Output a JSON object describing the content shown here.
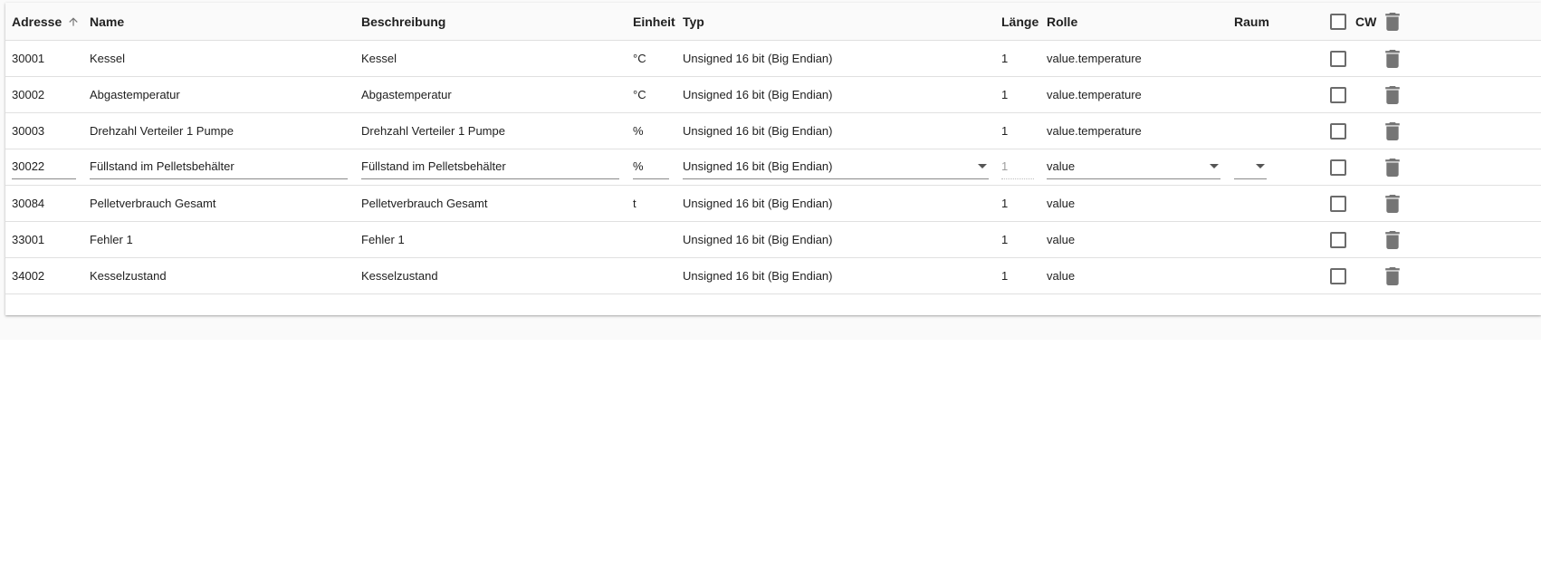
{
  "table": {
    "headers": {
      "adresse": "Adresse",
      "name": "Name",
      "beschreibung": "Beschreibung",
      "einheit": "Einheit",
      "typ": "Typ",
      "laenge": "Länge",
      "rolle": "Rolle",
      "raum": "Raum",
      "cw": "CW"
    },
    "rows": [
      {
        "adresse": "30001",
        "name": "Kessel",
        "beschreibung": "Kessel",
        "einheit": "°C",
        "typ": "Unsigned 16 bit (Big Endian)",
        "laenge": "1",
        "rolle": "value.temperature",
        "raum": ""
      },
      {
        "adresse": "30002",
        "name": "Abgastemperatur",
        "beschreibung": "Abgastemperatur",
        "einheit": "°C",
        "typ": "Unsigned 16 bit (Big Endian)",
        "laenge": "1",
        "rolle": "value.temperature",
        "raum": ""
      },
      {
        "adresse": "30003",
        "name": "Drehzahl Verteiler 1 Pumpe",
        "beschreibung": "Drehzahl Verteiler 1 Pumpe",
        "einheit": "%",
        "typ": "Unsigned 16 bit (Big Endian)",
        "laenge": "1",
        "rolle": "value.temperature",
        "raum": ""
      },
      {
        "adresse": "30022",
        "name": "Füllstand im Pelletsbehälter",
        "beschreibung": "Füllstand im Pelletsbehälter",
        "einheit": "%",
        "typ": "Unsigned 16 bit (Big Endian)",
        "laenge": "1",
        "rolle": "value",
        "raum": ""
      },
      {
        "adresse": "30084",
        "name": "Pelletverbrauch Gesamt",
        "beschreibung": "Pelletverbrauch Gesamt",
        "einheit": "t",
        "typ": "Unsigned 16 bit (Big Endian)",
        "laenge": "1",
        "rolle": "value",
        "raum": ""
      },
      {
        "adresse": "33001",
        "name": "Fehler 1",
        "beschreibung": "Fehler 1",
        "einheit": "",
        "typ": "Unsigned 16 bit (Big Endian)",
        "laenge": "1",
        "rolle": "value",
        "raum": ""
      },
      {
        "adresse": "34002",
        "name": "Kesselzustand",
        "beschreibung": "Kesselzustand",
        "einheit": "",
        "typ": "Unsigned 16 bit (Big Endian)",
        "laenge": "1",
        "rolle": "value",
        "raum": ""
      }
    ],
    "editing_row_index": 3,
    "icons": {
      "sort": "arrow-up-icon",
      "delete": "trash-icon",
      "dropdown": "caret-down-icon"
    }
  }
}
